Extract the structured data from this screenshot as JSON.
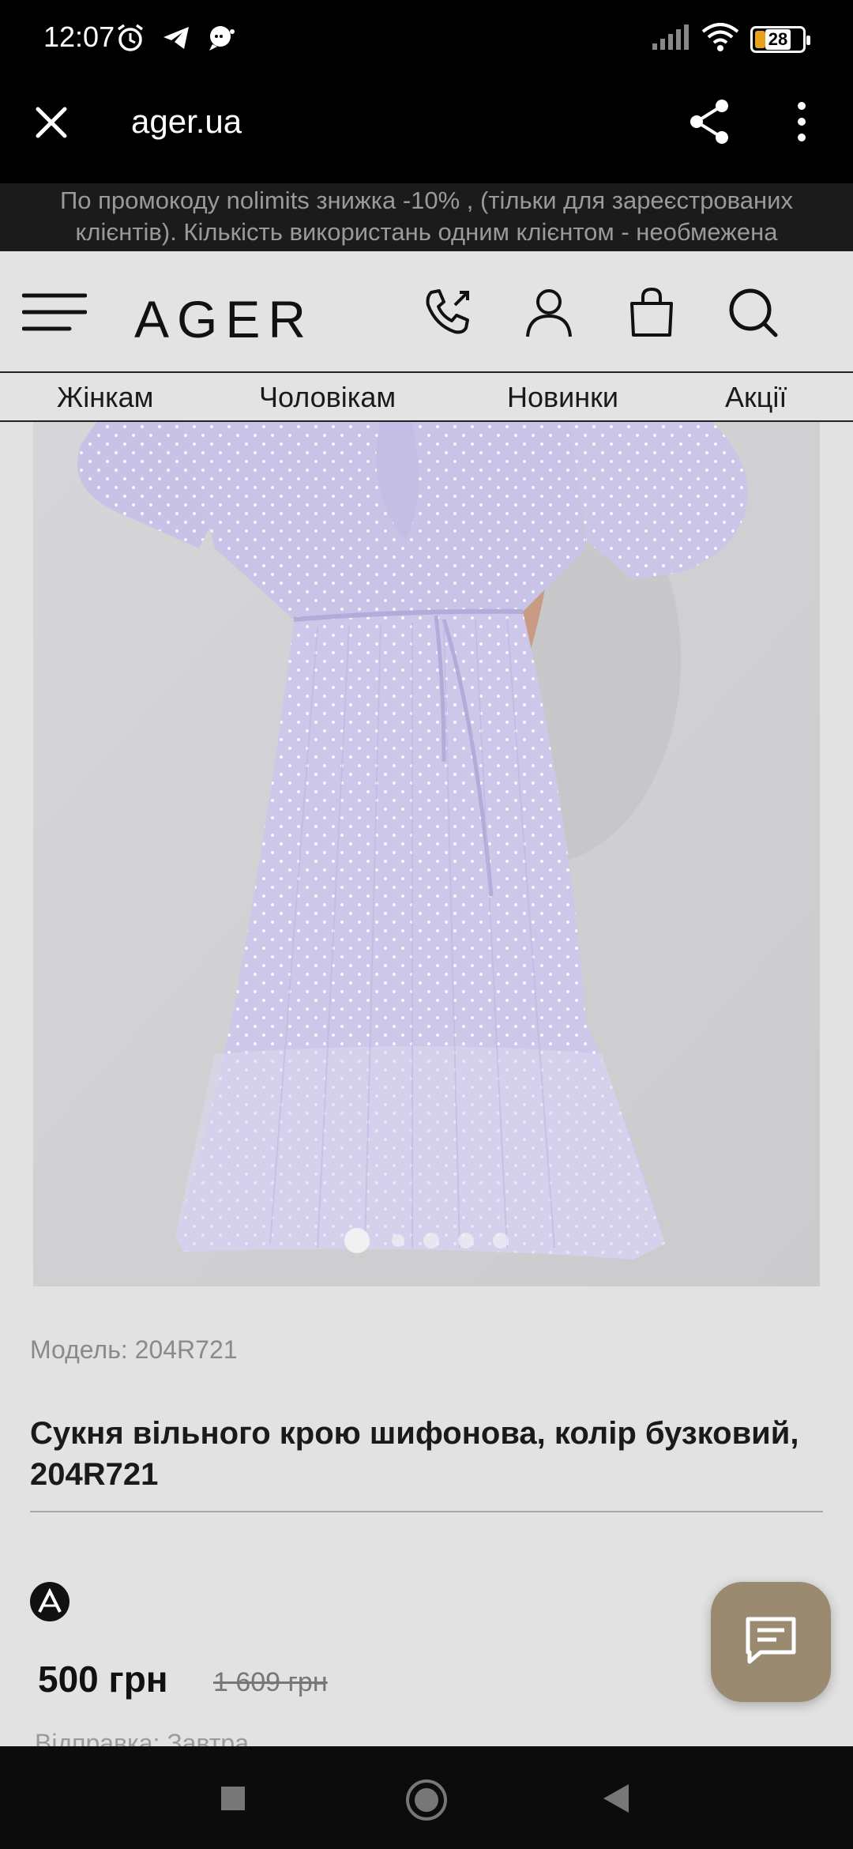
{
  "status_bar": {
    "time": "12:07",
    "battery_level": "28",
    "notification_icons": [
      "alarm-icon",
      "telegram-icon",
      "chat-bubble-icon"
    ],
    "right_icons": [
      "signal-icon",
      "wifi-icon",
      "battery-icon"
    ]
  },
  "browser": {
    "url": "ager.ua",
    "close_icon": "close-icon",
    "share_icon": "share-icon",
    "more_icon": "more-vertical-icon"
  },
  "promo_banner": {
    "line1": "По промокоду nolimits знижка -10% , (тільки для зареєстрованих",
    "line2": "клієнтів). Кількість використань одним клієнтом - необмежена"
  },
  "header": {
    "logo": "AGER",
    "icons": [
      "menu-icon",
      "phone-icon",
      "account-icon",
      "bag-icon",
      "search-icon"
    ]
  },
  "nav": {
    "items": [
      {
        "label": "Жінкам"
      },
      {
        "label": "Чоловікам"
      },
      {
        "label": "Новинки"
      },
      {
        "label": "Акції"
      }
    ]
  },
  "gallery": {
    "slide_count": 5,
    "active_slide": 1
  },
  "product": {
    "model": "Модель: 204R721",
    "title": "Сукня вільного крою шифонова, колір бузковий, 204R721",
    "price": "500 грн",
    "old_price": "1 609 грн",
    "shipping": "Відправка: Завтра"
  },
  "colors": {
    "promo_bg": "#1b1b1b",
    "page_bg": "#e2e2e2",
    "chat_button": "#9a8a6f",
    "dress": "#c9c4e6"
  },
  "system_nav": [
    "recents-button",
    "home-button",
    "back-button"
  ]
}
